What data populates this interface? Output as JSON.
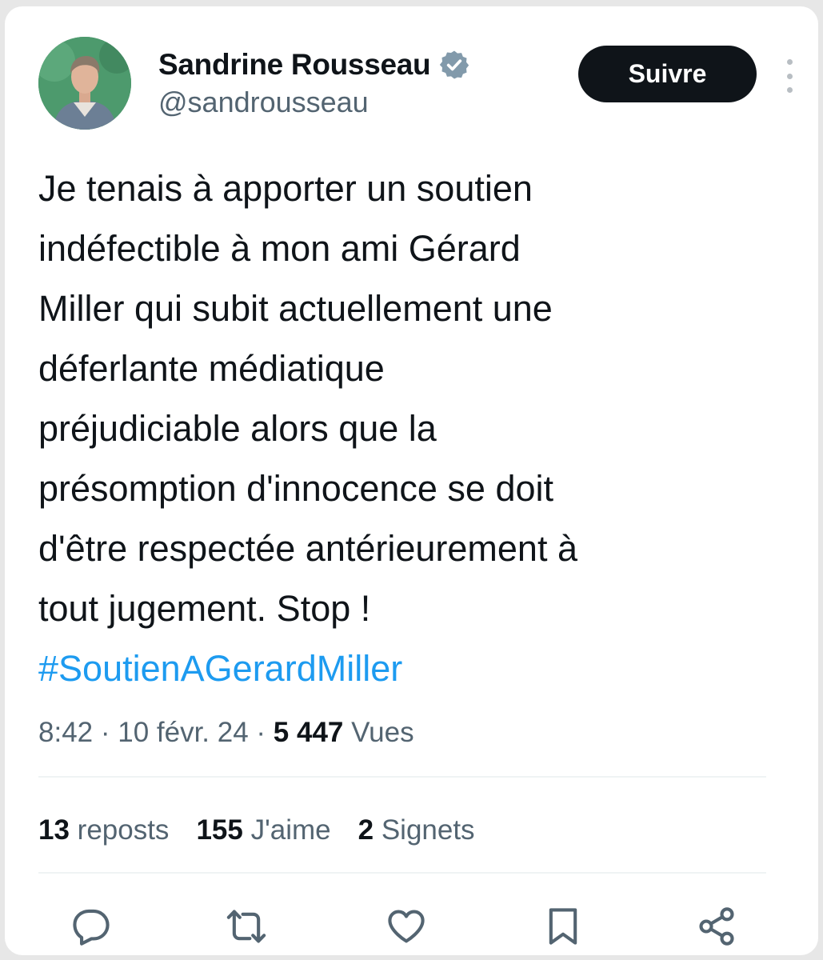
{
  "author": {
    "name": "Sandrine Rousseau",
    "handle": "@sandrousseau",
    "verified_icon": "verified-badge-icon"
  },
  "follow_button": {
    "label": "Suivre"
  },
  "tweet": {
    "lines": [
      "Je tenais à apporter un soutien",
      "indéfectible à mon ami Gérard",
      "Miller qui subit actuellement une",
      "déferlante médiatique",
      "préjudiciable alors que la",
      "présomption d'innocence se doit",
      "d'être respectée antérieurement à",
      "tout jugement. Stop !"
    ],
    "hashtag": "#SoutienAGerardMiller"
  },
  "meta": {
    "time": "8:42",
    "sep1": " · ",
    "date": "10 févr. 24",
    "sep2": " · ",
    "views_count": "5 447",
    "views_label": " Vues"
  },
  "stats": {
    "reposts": {
      "count": "13",
      "label": " reposts"
    },
    "likes": {
      "count": "155",
      "label": " J'aime"
    },
    "bookmarks": {
      "count": "2",
      "label": " Signets"
    }
  },
  "actions": [
    "reply-icon",
    "repost-icon",
    "like-icon",
    "bookmark-icon",
    "share-icon"
  ],
  "colors": {
    "text": "#0f1419",
    "secondary": "#536471",
    "link": "#1d9bf0",
    "button_bg": "#0f1419",
    "verified": "#829aab"
  }
}
